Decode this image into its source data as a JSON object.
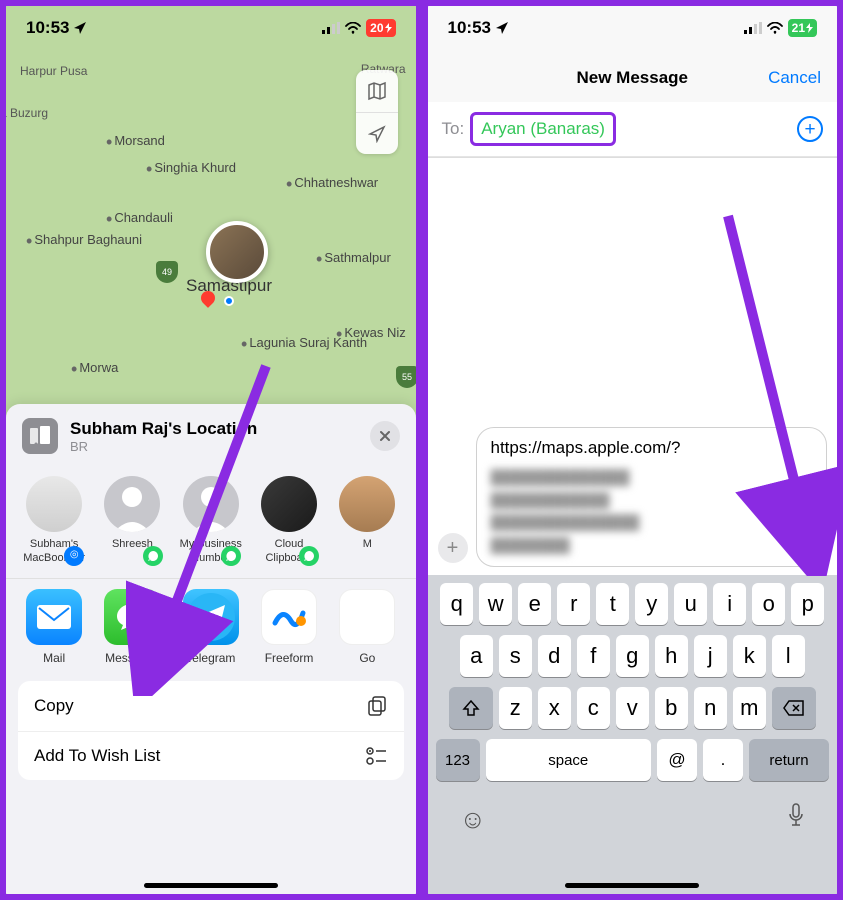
{
  "left": {
    "status": {
      "time": "10:53",
      "battery": "20"
    },
    "map": {
      "labels": [
        "Harpur Pusa",
        "Morsand",
        "Singhia Khurd",
        "Chhatneshwar",
        "Chandauli",
        "Shahpur Baghauni",
        "Sathmalpur",
        "Kewas Niz",
        "Lagunia Suraj Kanth",
        "Morwa",
        "a Buzurg",
        "Ratwara"
      ],
      "center_city": "Samastipur",
      "highways": [
        "49",
        "55"
      ]
    },
    "sheet": {
      "title": "Subham Raj's Location",
      "subtitle": "BR",
      "contacts": [
        {
          "name": "Subham's MacBook Air",
          "type": "mac"
        },
        {
          "name": "Shreesh",
          "type": "wa"
        },
        {
          "name": "My Business Number",
          "type": "wa"
        },
        {
          "name": "Cloud Clipboard",
          "type": "wa"
        },
        {
          "name": "M",
          "type": "plain"
        }
      ],
      "apps": [
        {
          "name": "Mail"
        },
        {
          "name": "Messages"
        },
        {
          "name": "Telegram"
        },
        {
          "name": "Freeform"
        },
        {
          "name": "Go"
        }
      ],
      "actions": {
        "copy": "Copy",
        "wish": "Add To Wish List"
      }
    }
  },
  "right": {
    "status": {
      "time": "10:53",
      "battery": "21"
    },
    "message": {
      "title": "New Message",
      "cancel": "Cancel",
      "to_label": "To:",
      "to_value": "Aryan (Banaras)",
      "url": "https://maps.apple.com/?"
    },
    "keyboard": {
      "row1": [
        "q",
        "w",
        "e",
        "r",
        "t",
        "y",
        "u",
        "i",
        "o",
        "p"
      ],
      "row2": [
        "a",
        "s",
        "d",
        "f",
        "g",
        "h",
        "j",
        "k",
        "l"
      ],
      "row3": [
        "z",
        "x",
        "c",
        "v",
        "b",
        "n",
        "m"
      ],
      "bottom": {
        "numbers": "123",
        "space": "space",
        "at": "@",
        "dot": ".",
        "return": "return"
      }
    }
  }
}
